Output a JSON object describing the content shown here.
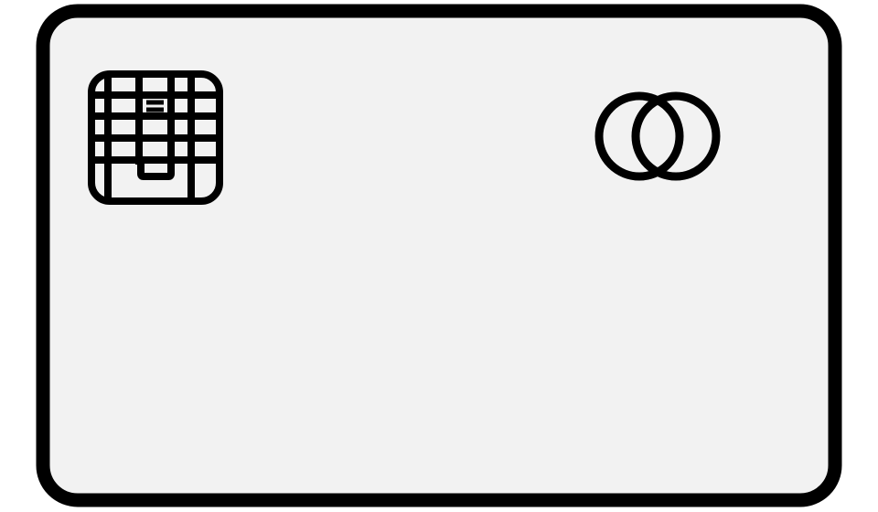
{
  "card": {
    "fill_color": "#f2f2f2",
    "stroke_color": "#000000",
    "icons": {
      "chip": "chip-icon",
      "brand_logo": "mastercard-logo-icon"
    }
  }
}
